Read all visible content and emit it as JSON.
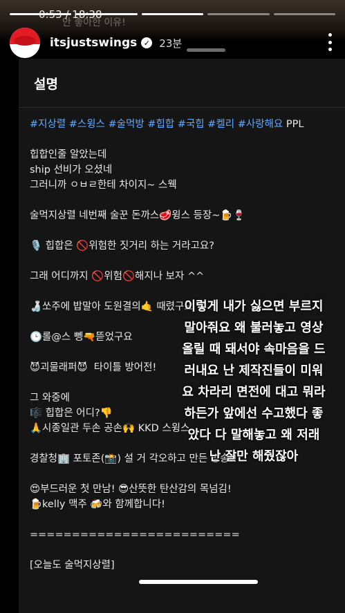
{
  "status": {
    "clock": "0:53 / 18:38",
    "ghost_line": "안 좋아한 이유!"
  },
  "header": {
    "username": "itsjustswings",
    "verified_icon": "verified-badge-icon",
    "time_ago": "23분"
  },
  "card": {
    "title": "설명",
    "hashtags": [
      "#지상렬",
      "#스윙스",
      "#술먹방",
      "#힙합",
      "#국힙",
      "#켈리",
      "#사랑해요"
    ],
    "ppl": "PPL",
    "lines": [
      "힙합인줄 알았는데",
      "ship 선비가 오셨네",
      "그러니까 ㅇㅂㄹ한테 차이지~ 스웩",
      "",
      "술먹지상렬 네번째 술꾼 돈까스🥩윙스 등장~🍺🍷",
      "",
      "🎙️ 힙합은 🚫위험한 짓거리 하는 거라고요?",
      "",
      "그래 어디까지 🚫위험🚫해지나 보자 ^^",
      "",
      "🍶쏘주에 밥말아 도원결의🤙 때렸구요",
      "",
      "🕒롤@스 뼁🔫뜯었구요",
      "",
      "😈괴물래퍼😈  타이틀 방어전!",
      "",
      "그 와중에",
      "🎼 힙합은 어디?👎",
      "🙏시종일관 두손 공손🙌 KKD 스윙스",
      "",
      "경찰청🏢 포토존(📸) 설 거 각오하고 만든 방송!!",
      "",
      "😍부드러운 첫 만남! 😎산뜻한 탄산감의 목넘김!",
      "🍺kelly 맥주 🍻와 함께합니다!",
      "",
      "=========================",
      "",
      "[오늘도 술먹지상렬]"
    ]
  },
  "overlay": {
    "lines": [
      "이렇게 내가 싫으면 부르지",
      "말아줘요 왜 불러놓고 영상",
      "올릴 때 돼서야 속마음을 드",
      "러내요 난 제작진들이 미워",
      "요 차라리 면전에 대고 뭐라",
      "하든가 앞에선 수고했다 좋",
      "았다 다 말해놓고 왜 저래",
      "난 잘만 해줬잖아"
    ]
  }
}
